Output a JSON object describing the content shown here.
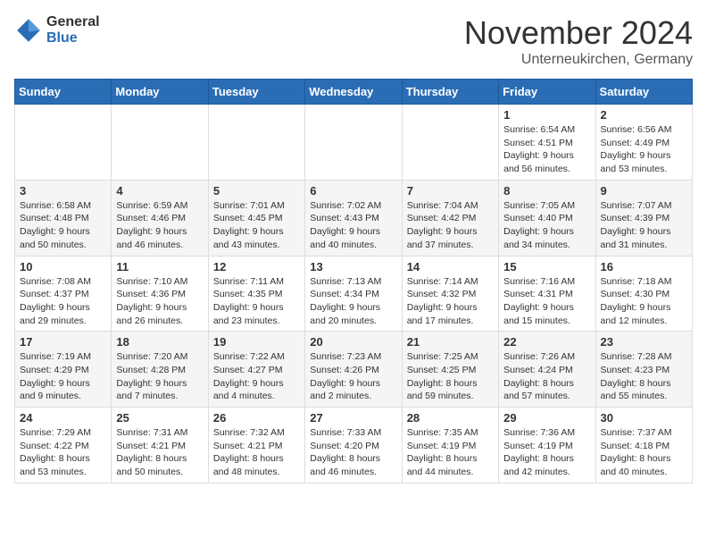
{
  "header": {
    "logo_general": "General",
    "logo_blue": "Blue",
    "month_title": "November 2024",
    "location": "Unterneukirchen, Germany"
  },
  "days_of_week": [
    "Sunday",
    "Monday",
    "Tuesday",
    "Wednesday",
    "Thursday",
    "Friday",
    "Saturday"
  ],
  "weeks": [
    {
      "cells": [
        {
          "day": "",
          "info": ""
        },
        {
          "day": "",
          "info": ""
        },
        {
          "day": "",
          "info": ""
        },
        {
          "day": "",
          "info": ""
        },
        {
          "day": "",
          "info": ""
        },
        {
          "day": "1",
          "info": "Sunrise: 6:54 AM\nSunset: 4:51 PM\nDaylight: 9 hours and 56 minutes."
        },
        {
          "day": "2",
          "info": "Sunrise: 6:56 AM\nSunset: 4:49 PM\nDaylight: 9 hours and 53 minutes."
        }
      ]
    },
    {
      "cells": [
        {
          "day": "3",
          "info": "Sunrise: 6:58 AM\nSunset: 4:48 PM\nDaylight: 9 hours and 50 minutes."
        },
        {
          "day": "4",
          "info": "Sunrise: 6:59 AM\nSunset: 4:46 PM\nDaylight: 9 hours and 46 minutes."
        },
        {
          "day": "5",
          "info": "Sunrise: 7:01 AM\nSunset: 4:45 PM\nDaylight: 9 hours and 43 minutes."
        },
        {
          "day": "6",
          "info": "Sunrise: 7:02 AM\nSunset: 4:43 PM\nDaylight: 9 hours and 40 minutes."
        },
        {
          "day": "7",
          "info": "Sunrise: 7:04 AM\nSunset: 4:42 PM\nDaylight: 9 hours and 37 minutes."
        },
        {
          "day": "8",
          "info": "Sunrise: 7:05 AM\nSunset: 4:40 PM\nDaylight: 9 hours and 34 minutes."
        },
        {
          "day": "9",
          "info": "Sunrise: 7:07 AM\nSunset: 4:39 PM\nDaylight: 9 hours and 31 minutes."
        }
      ]
    },
    {
      "cells": [
        {
          "day": "10",
          "info": "Sunrise: 7:08 AM\nSunset: 4:37 PM\nDaylight: 9 hours and 29 minutes."
        },
        {
          "day": "11",
          "info": "Sunrise: 7:10 AM\nSunset: 4:36 PM\nDaylight: 9 hours and 26 minutes."
        },
        {
          "day": "12",
          "info": "Sunrise: 7:11 AM\nSunset: 4:35 PM\nDaylight: 9 hours and 23 minutes."
        },
        {
          "day": "13",
          "info": "Sunrise: 7:13 AM\nSunset: 4:34 PM\nDaylight: 9 hours and 20 minutes."
        },
        {
          "day": "14",
          "info": "Sunrise: 7:14 AM\nSunset: 4:32 PM\nDaylight: 9 hours and 17 minutes."
        },
        {
          "day": "15",
          "info": "Sunrise: 7:16 AM\nSunset: 4:31 PM\nDaylight: 9 hours and 15 minutes."
        },
        {
          "day": "16",
          "info": "Sunrise: 7:18 AM\nSunset: 4:30 PM\nDaylight: 9 hours and 12 minutes."
        }
      ]
    },
    {
      "cells": [
        {
          "day": "17",
          "info": "Sunrise: 7:19 AM\nSunset: 4:29 PM\nDaylight: 9 hours and 9 minutes."
        },
        {
          "day": "18",
          "info": "Sunrise: 7:20 AM\nSunset: 4:28 PM\nDaylight: 9 hours and 7 minutes."
        },
        {
          "day": "19",
          "info": "Sunrise: 7:22 AM\nSunset: 4:27 PM\nDaylight: 9 hours and 4 minutes."
        },
        {
          "day": "20",
          "info": "Sunrise: 7:23 AM\nSunset: 4:26 PM\nDaylight: 9 hours and 2 minutes."
        },
        {
          "day": "21",
          "info": "Sunrise: 7:25 AM\nSunset: 4:25 PM\nDaylight: 8 hours and 59 minutes."
        },
        {
          "day": "22",
          "info": "Sunrise: 7:26 AM\nSunset: 4:24 PM\nDaylight: 8 hours and 57 minutes."
        },
        {
          "day": "23",
          "info": "Sunrise: 7:28 AM\nSunset: 4:23 PM\nDaylight: 8 hours and 55 minutes."
        }
      ]
    },
    {
      "cells": [
        {
          "day": "24",
          "info": "Sunrise: 7:29 AM\nSunset: 4:22 PM\nDaylight: 8 hours and 53 minutes."
        },
        {
          "day": "25",
          "info": "Sunrise: 7:31 AM\nSunset: 4:21 PM\nDaylight: 8 hours and 50 minutes."
        },
        {
          "day": "26",
          "info": "Sunrise: 7:32 AM\nSunset: 4:21 PM\nDaylight: 8 hours and 48 minutes."
        },
        {
          "day": "27",
          "info": "Sunrise: 7:33 AM\nSunset: 4:20 PM\nDaylight: 8 hours and 46 minutes."
        },
        {
          "day": "28",
          "info": "Sunrise: 7:35 AM\nSunset: 4:19 PM\nDaylight: 8 hours and 44 minutes."
        },
        {
          "day": "29",
          "info": "Sunrise: 7:36 AM\nSunset: 4:19 PM\nDaylight: 8 hours and 42 minutes."
        },
        {
          "day": "30",
          "info": "Sunrise: 7:37 AM\nSunset: 4:18 PM\nDaylight: 8 hours and 40 minutes."
        }
      ]
    }
  ]
}
